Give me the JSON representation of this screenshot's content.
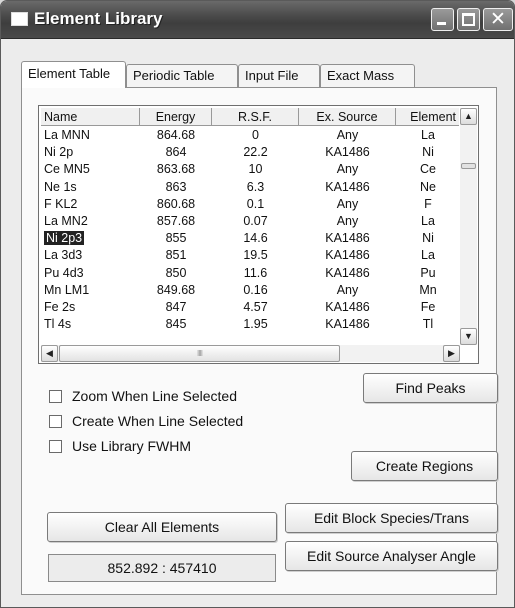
{
  "window": {
    "title": "Element Library",
    "controls": {
      "minimize": "minimize",
      "maximize": "maximize",
      "close": "✕"
    }
  },
  "tabs": [
    {
      "label": "Element Table",
      "active": true
    },
    {
      "label": "Periodic Table",
      "active": false
    },
    {
      "label": "Input File",
      "active": false
    },
    {
      "label": "Exact Mass",
      "active": false
    }
  ],
  "list": {
    "columns": [
      "Name",
      "Energy",
      "R.S.F.",
      "Ex. Source",
      "Element"
    ],
    "rows": [
      [
        "La MNN",
        "864.68",
        "0",
        "Any",
        "La"
      ],
      [
        "Ni 2p",
        "864",
        "22.2",
        "KA1486",
        "Ni"
      ],
      [
        "Ce MN5",
        "863.68",
        "10",
        "Any",
        "Ce"
      ],
      [
        "Ne 1s",
        "863",
        "6.3",
        "KA1486",
        "Ne"
      ],
      [
        "F KL2",
        "860.68",
        "0.1",
        "Any",
        "F"
      ],
      [
        "La MN2",
        "857.68",
        "0.07",
        "Any",
        "La"
      ],
      [
        "Ni 2p3",
        "855",
        "14.6",
        "KA1486",
        "Ni"
      ],
      [
        "La 3d3",
        "851",
        "19.5",
        "KA1486",
        "La"
      ],
      [
        "Pu 4d3",
        "850",
        "11.6",
        "KA1486",
        "Pu"
      ],
      [
        "Mn LM1",
        "849.68",
        "0.16",
        "Any",
        "Mn"
      ],
      [
        "Fe 2s",
        "847",
        "4.57",
        "KA1486",
        "Fe"
      ],
      [
        "Tl 4s",
        "845",
        "1.95",
        "KA1486",
        "Tl"
      ]
    ],
    "selected_row": 6,
    "scroll": {
      "up": "▲",
      "down": "▼",
      "left": "◀",
      "right": "▶",
      "grip": "IIII"
    }
  },
  "options": {
    "zoom_label": "Zoom When Line Selected",
    "create_label": "Create When Line Selected",
    "fwhm_label": "Use Library FWHM"
  },
  "buttons": {
    "find_peaks": "Find Peaks",
    "create_regions": "Create Regions",
    "clear_all": "Clear All Elements",
    "edit_block": "Edit Block Species/Trans",
    "edit_source": "Edit Source Analyser Angle"
  },
  "status": {
    "readout": "852.892 : 457410"
  }
}
